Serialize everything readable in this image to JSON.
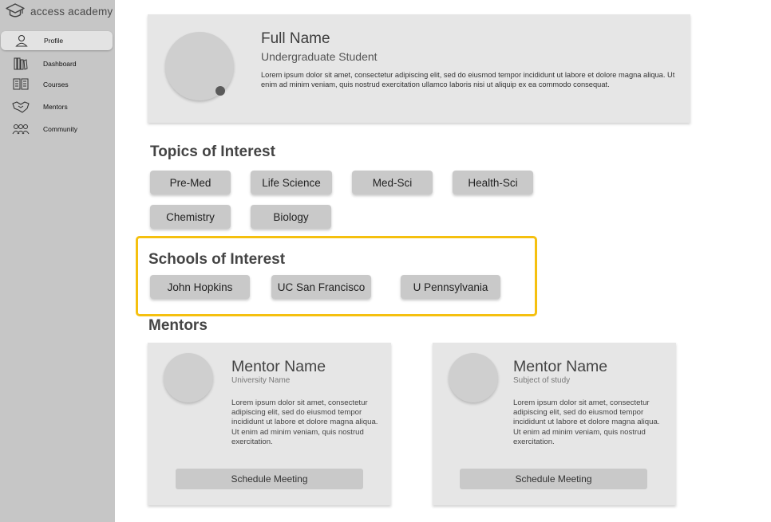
{
  "brand": {
    "name": "access academy",
    "icon": "graduation-cap-icon"
  },
  "sidebar": {
    "items": [
      {
        "label": "Profile",
        "icon": "user-icon",
        "active": true
      },
      {
        "label": "Dashboard",
        "icon": "books-icon"
      },
      {
        "label": "Courses",
        "icon": "open-book-icon"
      },
      {
        "label": "Mentors",
        "icon": "handshake-icon"
      },
      {
        "label": "Community",
        "icon": "people-group-icon"
      }
    ]
  },
  "profile": {
    "name": "Full Name",
    "role": "Undergraduate Student",
    "bio": "Lorem ipsum dolor sit amet, consectetur adipiscing elit, sed do eiusmod tempor incididunt ut labore et dolore magna aliqua. Ut enim ad minim veniam, quis nostrud exercitation ullamco laboris nisi ut aliquip ex ea commodo consequat."
  },
  "topics": {
    "title": "Topics of Interest",
    "items": [
      "Pre-Med",
      "Life Science",
      "Med-Sci",
      "Health-Sci",
      "Chemistry",
      "Biology"
    ]
  },
  "schools": {
    "title": "Schools of Interest",
    "items": [
      "John Hopkins",
      "UC San Francisco",
      "U Pennsylvania"
    ],
    "highlight_color": "#f5c00f"
  },
  "mentors": {
    "title": "Mentors",
    "cards": [
      {
        "name": "Mentor Name",
        "subtitle": "University Name",
        "bio": "Lorem ipsum dolor sit amet, consectetur adipiscing elit, sed do eiusmod tempor incididunt ut labore et dolore magna aliqua. Ut enim ad minim veniam, quis nostrud exercitation.",
        "button": "Schedule Meeting"
      },
      {
        "name": "Mentor Name",
        "subtitle": "Subject of study",
        "bio": "Lorem ipsum dolor sit amet, consectetur adipiscing elit, sed do eiusmod tempor incididunt ut labore et dolore magna aliqua. Ut enim ad minim veniam, quis nostrud exercitation.",
        "button": "Schedule Meeting"
      }
    ]
  }
}
